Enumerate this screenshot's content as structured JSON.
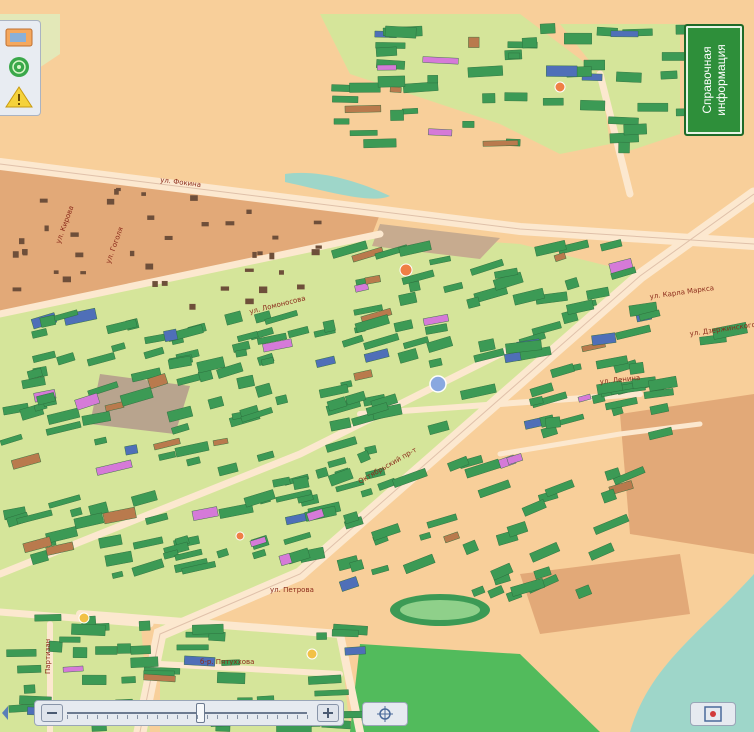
{
  "info_button": {
    "label_line1": "Справочная",
    "label_line2": "информация"
  },
  "street_labels": [
    "ул. Фокина",
    "ул. Ломоносова",
    "ул. Ленина",
    "Октябрьский пр-т",
    "ул. Карла Маркса",
    "ул. Кирова",
    "ул. Гоголя",
    "ул. Петрова",
    "б-р. Пятуххова",
    "Партизан",
    "ул. Дзержинского"
  ],
  "zoom": {
    "level": 0.55
  },
  "colors": {
    "residential": "#d5e59a",
    "industrial": "#e2a978",
    "background": "#f8cf9a",
    "building": "#3c9a55",
    "road": "#fce8cf",
    "water": "#9ed6c9",
    "park": "#52bb5c"
  },
  "icons": [
    "layers-icon",
    "radar-icon",
    "warning-icon",
    "locate-icon",
    "fullscreen-icon"
  ]
}
